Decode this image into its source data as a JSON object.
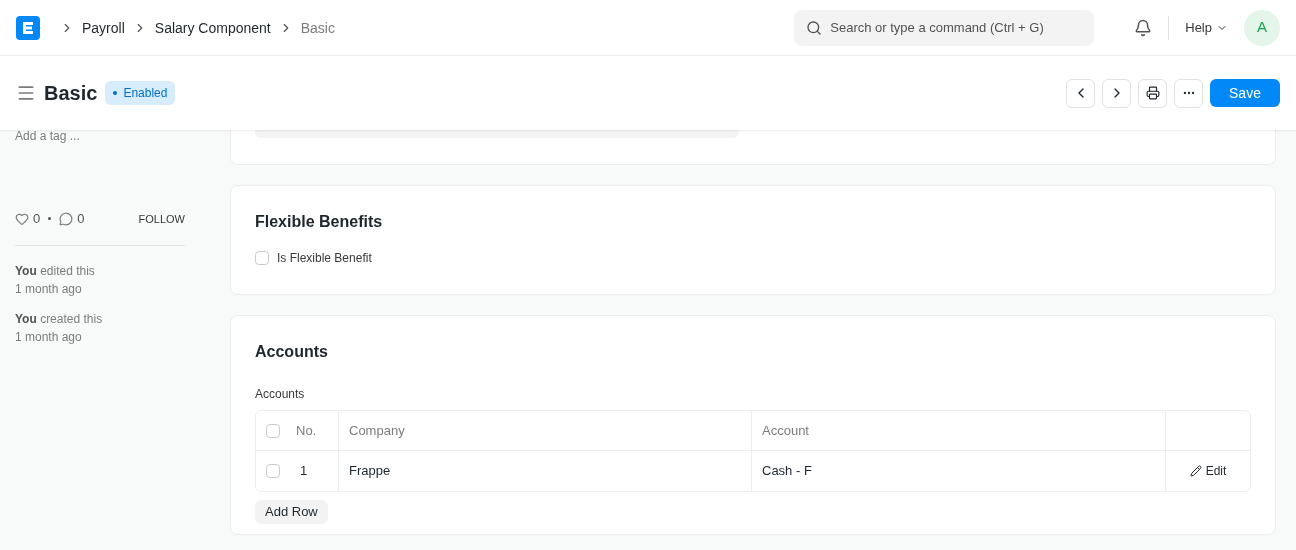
{
  "breadcrumbs": [
    "Payroll",
    "Salary Component",
    "Basic"
  ],
  "search": {
    "placeholder": "Search or type a command (Ctrl + G)"
  },
  "help": "Help",
  "avatar": "A",
  "title": "Basic",
  "status": "Enabled",
  "save": "Save",
  "sidebar": {
    "add_tag": "Add a tag ...",
    "likes": "0",
    "comments": "0",
    "follow": "FOLLOW",
    "activity": [
      {
        "who": "You",
        "action": "edited this",
        "when": "1 month ago"
      },
      {
        "who": "You",
        "action": "created this",
        "when": "1 month ago"
      }
    ]
  },
  "flexible": {
    "title": "Flexible Benefits",
    "checkbox": {
      "label": "Is Flexible Benefit",
      "checked": false
    }
  },
  "accounts": {
    "title": "Accounts",
    "label": "Accounts",
    "columns": [
      "No.",
      "Company",
      "Account"
    ],
    "select_all_checked": false,
    "rows": [
      {
        "no": "1",
        "company": "Frappe",
        "account": "Cash - F",
        "edit": "Edit",
        "checked": false
      }
    ],
    "add_row": "Add Row"
  }
}
